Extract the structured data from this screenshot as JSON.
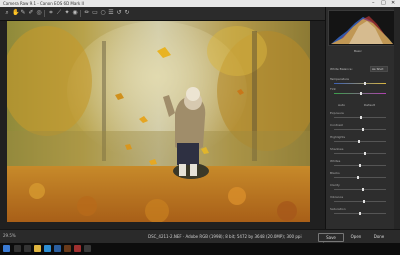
{
  "window": {
    "title": "Camera Raw 9.1 - Canon EOS 6D Mark II",
    "minimize": "–",
    "maximize": "□",
    "close": "✕"
  },
  "toolbar": {
    "icons": [
      "zoom-icon",
      "hand-icon",
      "white-balance-icon",
      "color-sampler-icon",
      "target-adjust-icon",
      "crop-icon",
      "straighten-icon",
      "spot-removal-icon",
      "red-eye-icon",
      "adjustment-brush-icon",
      "graduated-filter-icon",
      "radial-filter-icon",
      "preferences-icon",
      "rotate-ccw-icon",
      "rotate-cw-icon"
    ]
  },
  "panel": {
    "tab_label": "Basic",
    "white_balance_label": "White Balance:",
    "white_balance_value": "As Shot",
    "temperature_label": "Temperature",
    "tint_label": "Tint",
    "auto_label": "Auto",
    "default_label": "Default",
    "sliders": [
      "Exposure",
      "Contrast",
      "Highlights",
      "Shadows",
      "Whites",
      "Blacks",
      "Clarity",
      "Vibrance",
      "Saturation"
    ],
    "slider_levels": [
      0.52,
      0.55,
      0.48,
      0.6,
      0.5,
      0.46,
      0.55,
      0.58,
      0.5
    ],
    "extra_labels": [
      "Clarity",
      "Vibrance",
      "Saturation",
      "Dehaze"
    ]
  },
  "status": {
    "zoom": "29.5%",
    "filename": "DSC_4211-2.NEF · Adobe RGB (1998); 8 bit; 5472 by 3648 (20.0MP); 300 ppi",
    "save_label": "Save Image...",
    "open_label": "Open",
    "done_label": "Done"
  },
  "colors": {
    "accent": "#4a90d9",
    "panel_bg": "#2d2d2d",
    "foliage": "#c98a24"
  }
}
